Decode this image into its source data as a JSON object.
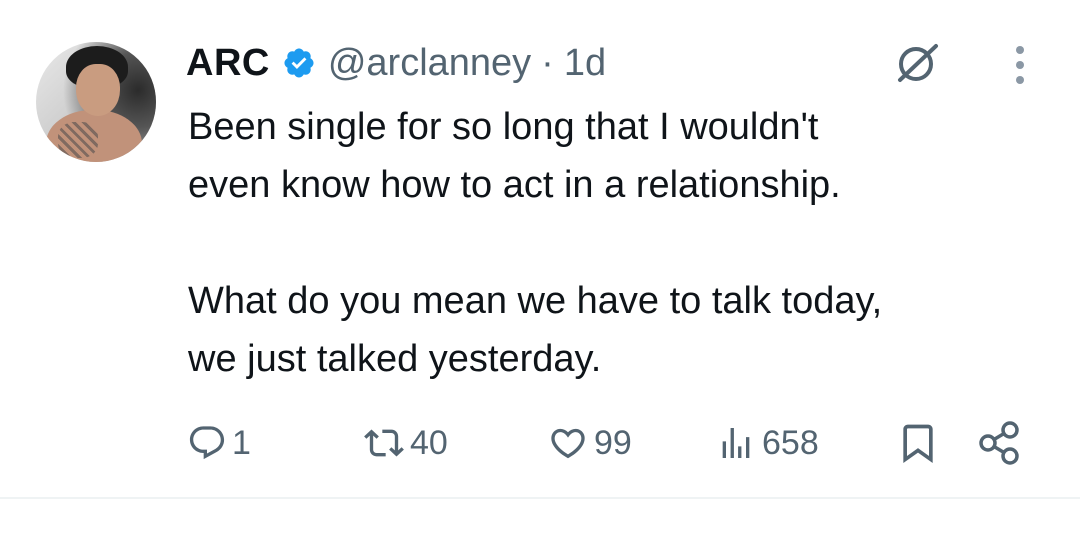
{
  "tweet": {
    "author": {
      "name": "ARC",
      "handle": "@arclanney",
      "verified": true,
      "verified_color": "#1d9bf0"
    },
    "separator": "·",
    "time": "1d",
    "text": {
      "paragraph1": "Been single for so long that I wouldn't\neven know how to act in a relationship.",
      "paragraph2": "What do you mean we have to talk today,\nwe just talked yesterday."
    },
    "icons": {
      "grok": "grok-icon",
      "more": "more-options-icon"
    },
    "actions": {
      "replies": "1",
      "reposts": "40",
      "likes": "99",
      "views": "658"
    }
  },
  "colors": {
    "text": "#0f1419",
    "secondary": "#536471",
    "divider": "#eff3f4"
  }
}
